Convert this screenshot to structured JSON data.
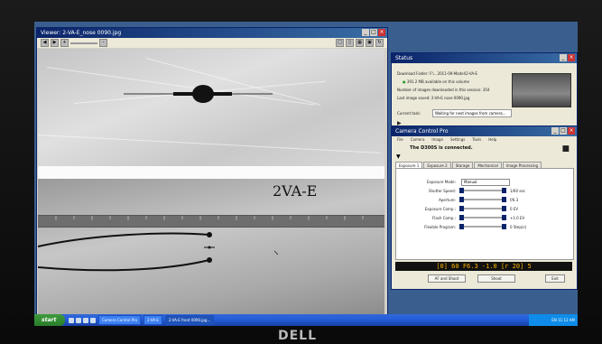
{
  "brand": "DELL",
  "viewer": {
    "title": "Viewer: 2-VA-E_nose 0090.jpg",
    "annotation": "2VA-E"
  },
  "status": {
    "title": "Status",
    "download_folder_label": "Download Folder:",
    "download_folder_value": "F:\\...2011-09-Model\\2-VA-E",
    "space_label": "391.2 MB  available on this volume",
    "images_downloaded_label": "Number of images downloaded in this session:",
    "images_downloaded_value": "354",
    "last_image_label": "Last image saved:",
    "last_image_value": "2-VA-E nose 0090.jpg",
    "current_task_label": "Current task:",
    "current_task_value": "Waiting for next images from camera..."
  },
  "camera": {
    "title": "Camera Control Pro",
    "menu": [
      "File",
      "Camera",
      "Image",
      "Settings",
      "Tools",
      "Help"
    ],
    "message": "The D300S is connected.",
    "tabs": [
      "Exposure 1",
      "Exposure 2",
      "Storage",
      "Mechanical",
      "Image Processing"
    ],
    "fields": [
      {
        "label": "Exposure Mode:",
        "value": "Manual"
      },
      {
        "label": "Shutter Speed:",
        "value": "1/60 sec"
      },
      {
        "label": "Aperture:",
        "value": "f/6.3"
      },
      {
        "label": "Exposure Comp.:",
        "value": "0 EV"
      },
      {
        "label": "Flash Comp.:",
        "value": "+1.0 EV"
      },
      {
        "label": "Flexible Program:",
        "value": "0 Step(s)"
      }
    ],
    "lcd": "[0]   60  F6.3   -1.0   [r 20]  5",
    "af_button": "AF and Shoot",
    "shoot_button": "Shoot",
    "close_button": "Exit"
  },
  "taskbar": {
    "start": "start",
    "tasks": [
      "Camera Control Pro",
      "2-VA-E",
      "2-VA-E front 0090.jpg..."
    ],
    "clock": "EN 11:12 AM"
  }
}
